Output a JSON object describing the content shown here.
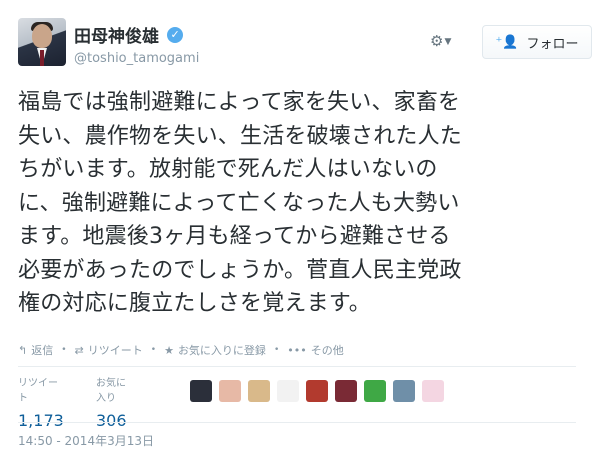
{
  "user": {
    "display_name": "田母神俊雄",
    "screen_name": "@toshio_tamogami",
    "verified_icon": "verified-badge-icon",
    "avatar_icon": "profile-avatar"
  },
  "header": {
    "gear_icon": "gear-icon",
    "follow_label": "フォロー",
    "follow_icon": "add-user-icon"
  },
  "tweet": {
    "lines": [
      "福島では強制避難によって家を失い、家畜を",
      "失い、農作物を失い、生活を破壊された人た",
      "ちがいます。放射能で死んだ人はいないの",
      "に、強制避難によって亡くなった人も大勢い",
      "ます。地震後3ヶ月も経ってから避難させる",
      "必要があったのでしょうか。菅直人民主党政",
      "権の対応に腹立たしさを覚えます。"
    ]
  },
  "actions": {
    "reply": {
      "label": "返信",
      "icon": "reply-icon"
    },
    "retweet": {
      "label": "リツイート",
      "icon": "retweet-icon"
    },
    "favorite": {
      "label": "お気に入りに登録",
      "icon": "star-icon"
    },
    "more": {
      "label": "その他",
      "icon": "more-icon"
    }
  },
  "stats": {
    "retweets_label": "リツイート",
    "retweets_value": "1,173",
    "favorites_label": "お気に入り",
    "favorites_value": "306"
  },
  "favoriters": [
    {
      "name": "favoriter-avatar-1",
      "color": "#2b2f3a"
    },
    {
      "name": "favoriter-avatar-2",
      "color": "#e7b9a6"
    },
    {
      "name": "favoriter-avatar-3",
      "color": "#d9b98a"
    },
    {
      "name": "favoriter-avatar-4",
      "color": "#f2f2f2"
    },
    {
      "name": "favoriter-avatar-5",
      "color": "#b23a2e"
    },
    {
      "name": "favoriter-avatar-6",
      "color": "#7a2a35"
    },
    {
      "name": "favoriter-avatar-7",
      "color": "#3fa845"
    },
    {
      "name": "favoriter-avatar-8",
      "color": "#6f8fa8"
    },
    {
      "name": "favoriter-avatar-9",
      "color": "#f4d6e2"
    }
  ],
  "timestamp": "14:50 - 2014年3月13日",
  "colors": {
    "text": "#292f33",
    "muted": "#8899a6",
    "link": "#0f5f9a",
    "accent": "#55acee"
  }
}
